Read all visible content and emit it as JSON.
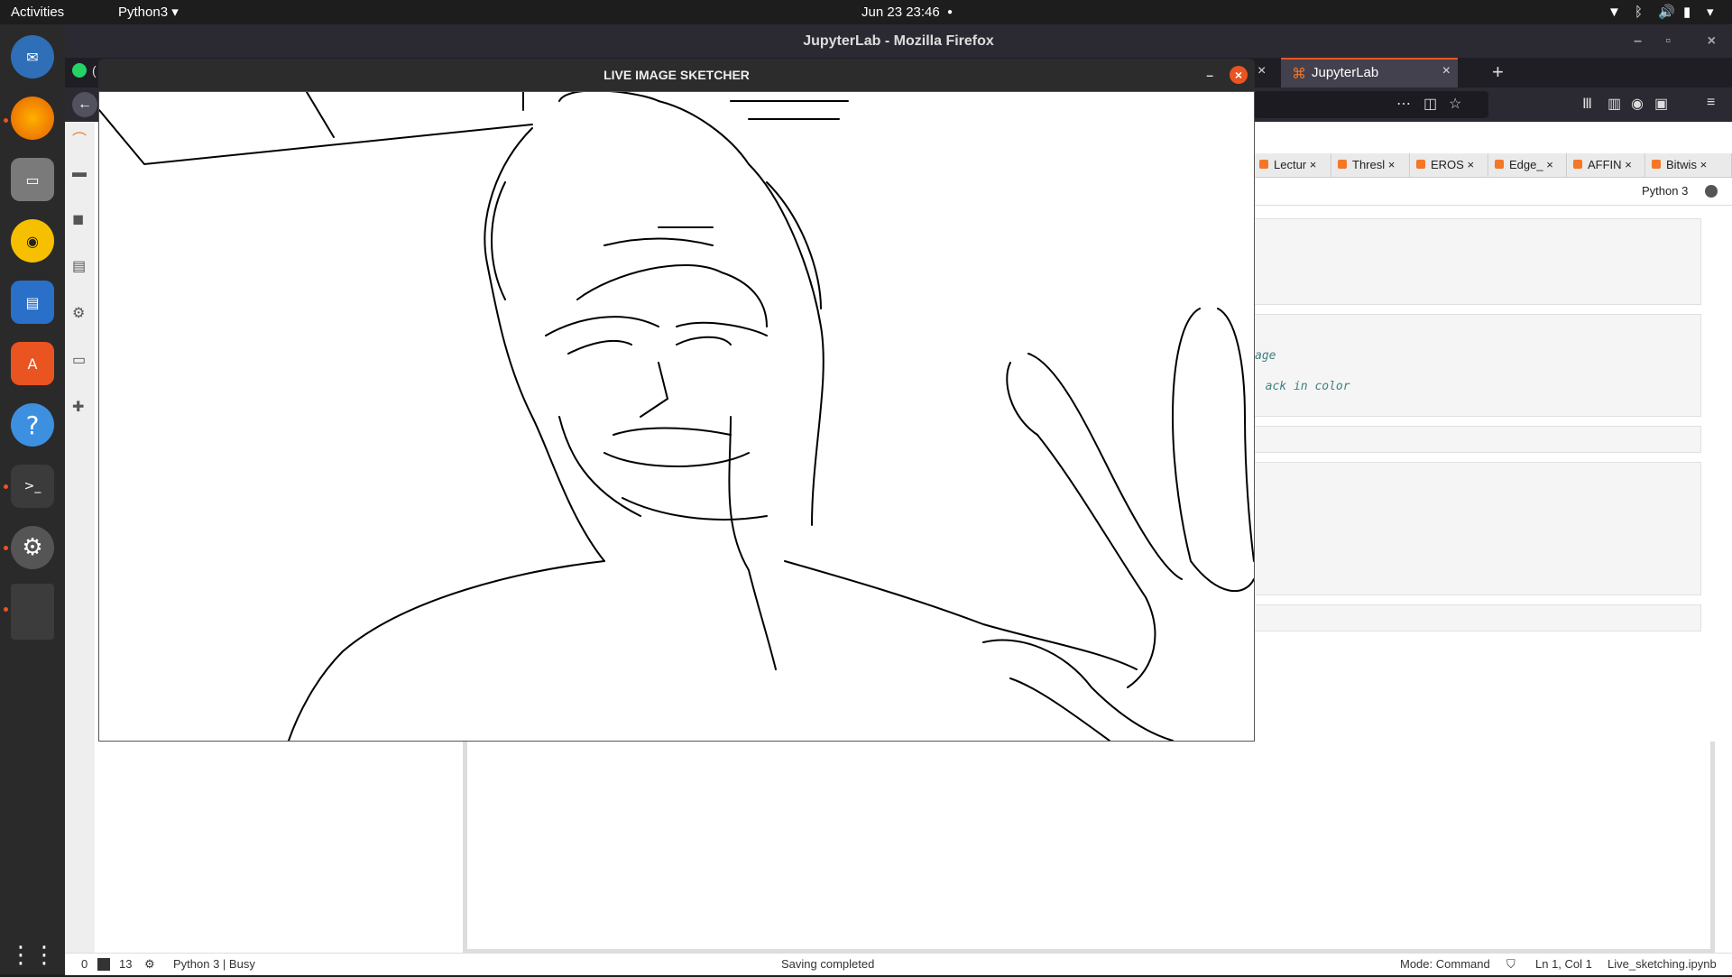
{
  "topbar": {
    "activities": "Activities",
    "app_menu": "Python3",
    "datetime": "Jun 23  23:46"
  },
  "dock": {
    "apps": [
      "thunderbird-icon",
      "firefox-icon",
      "files-icon",
      "rhythmbox-icon",
      "writer-icon",
      "software-icon",
      "help-icon",
      "terminal-icon",
      "settings-icon",
      "blank-app"
    ],
    "grid_icon": "show-applications-icon"
  },
  "firefox": {
    "window_title": "JupyterLab - Mozilla Firefox",
    "first_tab_fragment": "(",
    "tab_active": "JupyterLab",
    "new_tab": "+"
  },
  "jupyter": {
    "notebook_tabs": [
      "Lectur",
      "Thresl",
      "EROS",
      "Edge_",
      "AFFIN",
      "Bitwis"
    ],
    "kernel_name": "Python 3",
    "code_fragments": [
      "age",
      ", ack in color"
    ],
    "status": {
      "zero": "0",
      "terminals": "13",
      "kernel_state": "Python 3 | Busy",
      "message": "Saving completed",
      "mode": "Mode: Command",
      "cursor": "Ln 1, Col 1",
      "filename": "Live_sketching.ipynb"
    }
  },
  "sketcher": {
    "title": "LIVE IMAGE SKETCHER",
    "minimize": "–",
    "close": "×"
  },
  "colors": {
    "accent": "#e95420",
    "jupyter_orange": "#f37726",
    "code_italic": "#408080"
  }
}
